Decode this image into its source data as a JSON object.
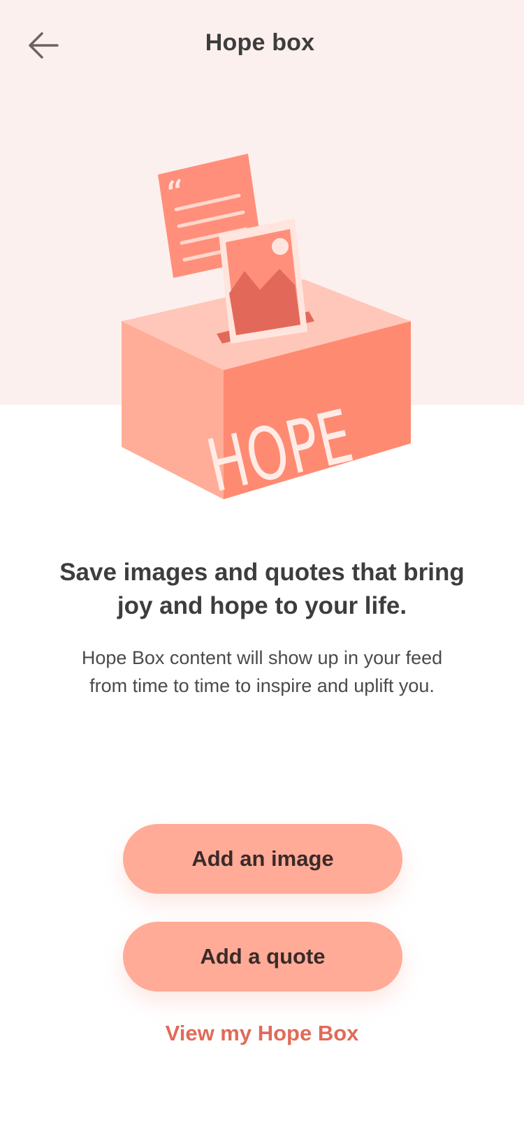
{
  "header": {
    "title": "Hope box",
    "back_icon": "arrow-left-icon"
  },
  "illustration": {
    "box_label": "HOPE",
    "icons": [
      "quote-card-icon",
      "photo-card-icon",
      "hope-box-icon"
    ]
  },
  "main": {
    "headline": "Save images and quotes that bring joy and hope to your life.",
    "description": "Hope Box content will show up in your feed from time to time to inspire and uplift you."
  },
  "actions": {
    "add_image_label": "Add an image",
    "add_quote_label": "Add a quote",
    "view_link_label": "View my Hope Box"
  },
  "colors": {
    "hero_background": "#fcf0ee",
    "button_fill": "#ffab97",
    "link_text": "#e06b58",
    "box_front": "#ff8a72",
    "box_side": "#ffad98",
    "box_top": "#ffc7b9"
  }
}
